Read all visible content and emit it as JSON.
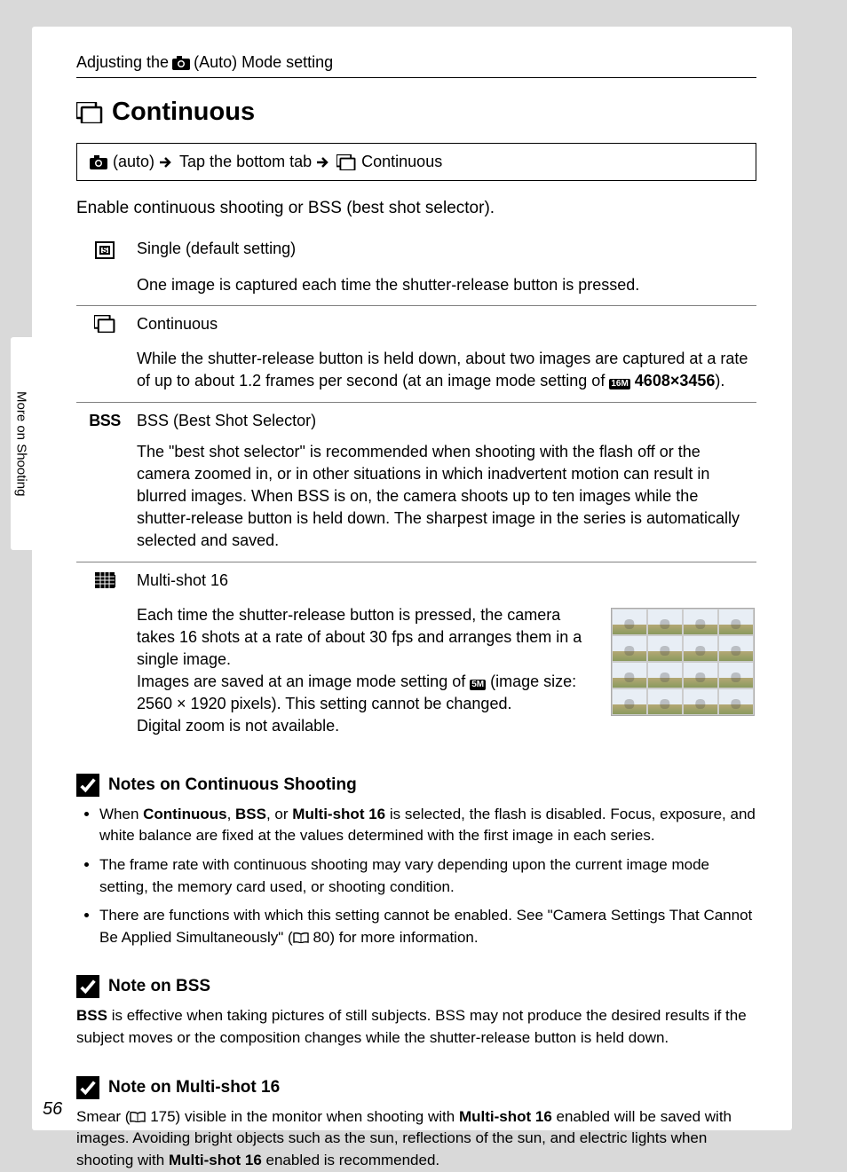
{
  "sidebar": {
    "label": "More on Shooting"
  },
  "header": {
    "prefix": "Adjusting the ",
    "suffix": " (Auto) Mode setting"
  },
  "title": "Continuous",
  "nav": {
    "part1a": "(auto)",
    "part2": "Tap the bottom tab",
    "part3": "Continuous"
  },
  "intro": "Enable continuous shooting or BSS (best shot selector).",
  "options": {
    "single": {
      "name": "Single (default setting)",
      "desc": "One image is captured each time the shutter-release button is pressed."
    },
    "continuous": {
      "name": "Continuous",
      "desc_a": "While the shutter-release button is held down, about two images are captured at a rate of up to about 1.2 frames per second (at an image mode setting of ",
      "desc_b_bold": "4608×3456",
      "desc_c": ")."
    },
    "bss": {
      "name": "BSS (Best Shot Selector)",
      "desc": "The \"best shot selector\" is recommended when shooting with the flash off or the camera zoomed in, or in other situations in which inadvertent motion can result in blurred images. When BSS is on, the camera shoots up to ten images while the shutter-release button is held down. The sharpest image in the series is automatically selected and saved."
    },
    "multi": {
      "name": "Multi-shot 16",
      "desc1": "Each time the shutter-release button is pressed, the camera takes 16 shots at a rate of about 30 fps and arranges them in a single image.",
      "desc2a": "Images are saved at an image mode setting of ",
      "desc2b": " (image size: 2560 × 1920 pixels). This setting cannot be changed.",
      "desc3": "Digital zoom is not available."
    }
  },
  "notes": {
    "continuous": {
      "heading": "Notes on Continuous Shooting",
      "items": {
        "i1a": "When ",
        "i1b": "Continuous",
        "i1c": ", ",
        "i1d": "BSS",
        "i1e": ", or ",
        "i1f": "Multi-shot 16",
        "i1g": " is selected, the flash is disabled. Focus, exposure, and white balance are fixed at the values determined with the first image in each series.",
        "i2": "The frame rate with continuous shooting may vary depending upon the current image mode setting, the memory card used, or shooting condition.",
        "i3a": "There are functions with which this setting cannot be enabled. See \"Camera Settings That Cannot Be Applied Simultaneously\" (",
        "i3b": " 80) for more information."
      }
    },
    "bss": {
      "heading": "Note on BSS",
      "body_a": "BSS",
      "body_b": " is effective when taking pictures of still subjects. BSS may not produce the desired results if the subject moves or the composition changes while the shutter-release button is held down."
    },
    "multi": {
      "heading": "Note on Multi-shot 16",
      "body_a": "Smear (",
      "body_b": " 175) visible in the monitor when shooting with ",
      "body_c": "Multi-shot 16",
      "body_d": " enabled will be saved with images. Avoiding bright objects such as the sun, reflections of the sun, and electric lights when shooting with ",
      "body_e": "Multi-shot 16",
      "body_f": " enabled is recommended."
    }
  },
  "page_number": "56",
  "icon_labels": {
    "px16m": "16M",
    "px5m": "5M",
    "bss": "BSS"
  }
}
